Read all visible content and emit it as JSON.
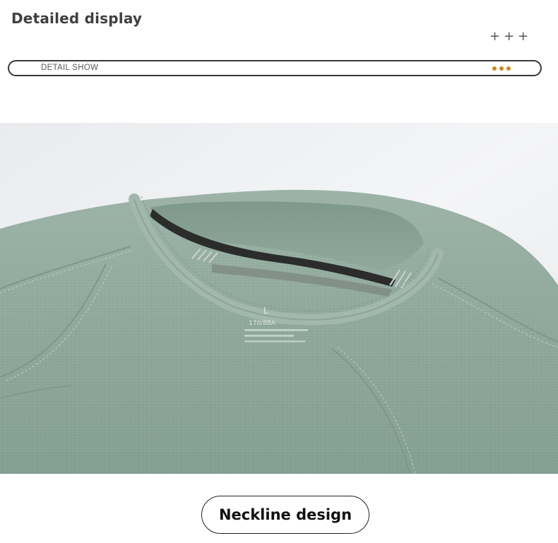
{
  "header": {
    "title": "Detailed display",
    "plus_marks": "+++"
  },
  "section_bar": {
    "label": "DETAIL SHOW",
    "dots_color": "#c98a1a",
    "dot_count": 3
  },
  "photo": {
    "subject": "neckline-closeup",
    "fabric_color": "#8fa89c",
    "label_text": {
      "size": "L",
      "measure": "170/88A"
    }
  },
  "caption": {
    "text": "Neckline design"
  }
}
